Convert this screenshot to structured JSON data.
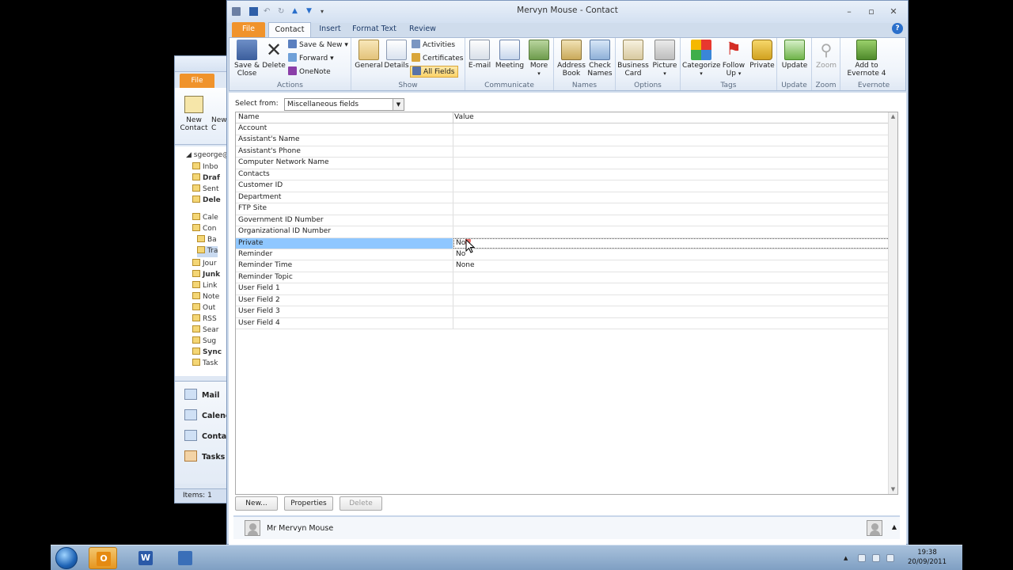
{
  "background_window": {
    "file_tab": "File",
    "ribbon_button": "New\nContact",
    "ribbon_button_cut": "New\nC",
    "account": "sgeorge@",
    "nav_items": [
      "Inbo",
      "Draf",
      "Sent",
      "Dele",
      "Cale",
      "Con",
      "Ba",
      "Tra",
      "Jour",
      "Junk",
      "Link",
      "Note",
      "Out",
      "RSS",
      "Sear",
      "Sug",
      "Sync",
      "Task"
    ],
    "modules": [
      "Mail",
      "Calenc",
      "Contac",
      "Tasks"
    ],
    "status": "Items: 1"
  },
  "window": {
    "title": "Mervyn Mouse  -  Contact",
    "tabs": [
      "File",
      "Contact",
      "Insert",
      "Format Text",
      "Review"
    ],
    "active_tab": "Contact"
  },
  "ribbon": {
    "actions": {
      "label": "Actions",
      "save_close": "Save &\nClose",
      "delete": "Delete",
      "save_new": "Save & New",
      "forward": "Forward",
      "onenote": "OneNote"
    },
    "show": {
      "label": "Show",
      "general": "General",
      "details": "Details",
      "activities": "Activities",
      "certificates": "Certificates",
      "all_fields": "All Fields"
    },
    "communicate": {
      "label": "Communicate",
      "email": "E-mail",
      "meeting": "Meeting",
      "more": "More"
    },
    "names": {
      "label": "Names",
      "address_book": "Address\nBook",
      "check_names": "Check\nNames"
    },
    "options": {
      "label": "Options",
      "business_card": "Business\nCard",
      "picture": "Picture"
    },
    "tags": {
      "label": "Tags",
      "categorize": "Categorize",
      "follow_up": "Follow\nUp",
      "private": "Private"
    },
    "update": {
      "label": "Update",
      "update": "Update"
    },
    "zoom": {
      "label": "Zoom",
      "zoom": "Zoom"
    },
    "evernote": {
      "label": "Evernote",
      "add": "Add to\nEvernote 4"
    }
  },
  "select_from": {
    "label": "Select from:",
    "value": "Miscellaneous fields"
  },
  "grid": {
    "headers": {
      "name": "Name",
      "value": "Value"
    },
    "rows": [
      {
        "name": "Account",
        "value": ""
      },
      {
        "name": "Assistant's Name",
        "value": ""
      },
      {
        "name": "Assistant's Phone",
        "value": ""
      },
      {
        "name": "Computer Network Name",
        "value": ""
      },
      {
        "name": "Contacts",
        "value": ""
      },
      {
        "name": "Customer ID",
        "value": ""
      },
      {
        "name": "Department",
        "value": ""
      },
      {
        "name": "FTP Site",
        "value": ""
      },
      {
        "name": "Government ID Number",
        "value": ""
      },
      {
        "name": "Organizational ID Number",
        "value": ""
      },
      {
        "name": "Private",
        "value": "No"
      },
      {
        "name": "Reminder",
        "value": "No"
      },
      {
        "name": "Reminder Time",
        "value": "None"
      },
      {
        "name": "Reminder Topic",
        "value": ""
      },
      {
        "name": "User Field 1",
        "value": ""
      },
      {
        "name": "User Field 2",
        "value": ""
      },
      {
        "name": "User Field 3",
        "value": ""
      },
      {
        "name": "User Field 4",
        "value": ""
      }
    ],
    "selected_index": 10
  },
  "buttons": {
    "new": "New...",
    "properties": "Properties",
    "delete": "Delete"
  },
  "people_pane": {
    "name": "Mr Mervyn Mouse"
  },
  "taskbar": {
    "time": "19:38",
    "date": "20/09/2011",
    "apps": [
      "outlook",
      "word",
      "video"
    ]
  },
  "colors": {
    "file_tab": "#f0932b",
    "selection": "#3399ff",
    "ribbon_bg": "#e5edf8"
  }
}
